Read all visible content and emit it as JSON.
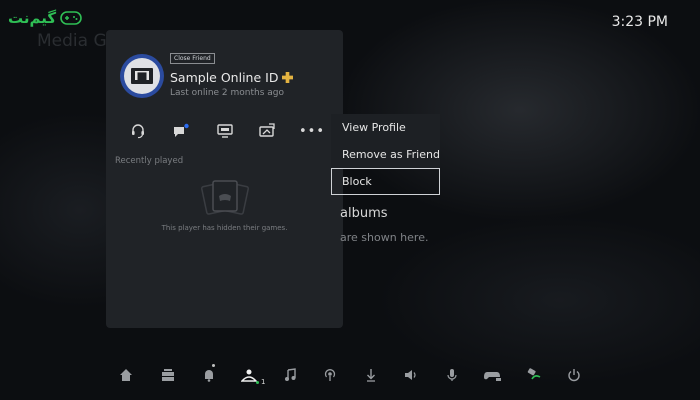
{
  "watermark": {
    "text": "گیم‌نت",
    "icon": "gamepad-icon",
    "color": "#2fbf55"
  },
  "clock": "3:23 PM",
  "background": {
    "title": "Media Ga",
    "albums_title": "albums",
    "albums_subtitle": "are shown here."
  },
  "profile_card": {
    "badge": "Close Friend",
    "online_id": "Sample Online ID",
    "plus_icon": "plus-icon",
    "plus_color": "#e3b341",
    "avatar_ring_color": "#2b4b9f",
    "last_online": "Last online 2 months ago",
    "actions": [
      {
        "name": "voice-chat-icon"
      },
      {
        "name": "message-icon",
        "badge_color": "#2b6cf0"
      },
      {
        "name": "share-screen-icon"
      },
      {
        "name": "share-play-icon"
      },
      {
        "name": "more-icon",
        "label": "•••"
      }
    ],
    "recently_played_label": "Recently played",
    "hidden_games_text": "This player has hidden their games."
  },
  "context_menu": {
    "items": [
      {
        "label": "View Profile"
      },
      {
        "label": "Remove as Friend"
      },
      {
        "label": "Block",
        "selected": true
      }
    ]
  },
  "dock": {
    "items": [
      {
        "name": "home-icon"
      },
      {
        "name": "game-base-icon"
      },
      {
        "name": "notifications-icon"
      },
      {
        "name": "game-base-friends-icon",
        "active": true,
        "count": "1"
      },
      {
        "name": "music-icon"
      },
      {
        "name": "broadcast-icon"
      },
      {
        "name": "downloads-icon"
      },
      {
        "name": "sound-icon"
      },
      {
        "name": "mic-icon"
      },
      {
        "name": "controller-icon"
      },
      {
        "name": "accessories-icon"
      },
      {
        "name": "power-icon"
      }
    ],
    "dot_color": "#2fbf55"
  }
}
